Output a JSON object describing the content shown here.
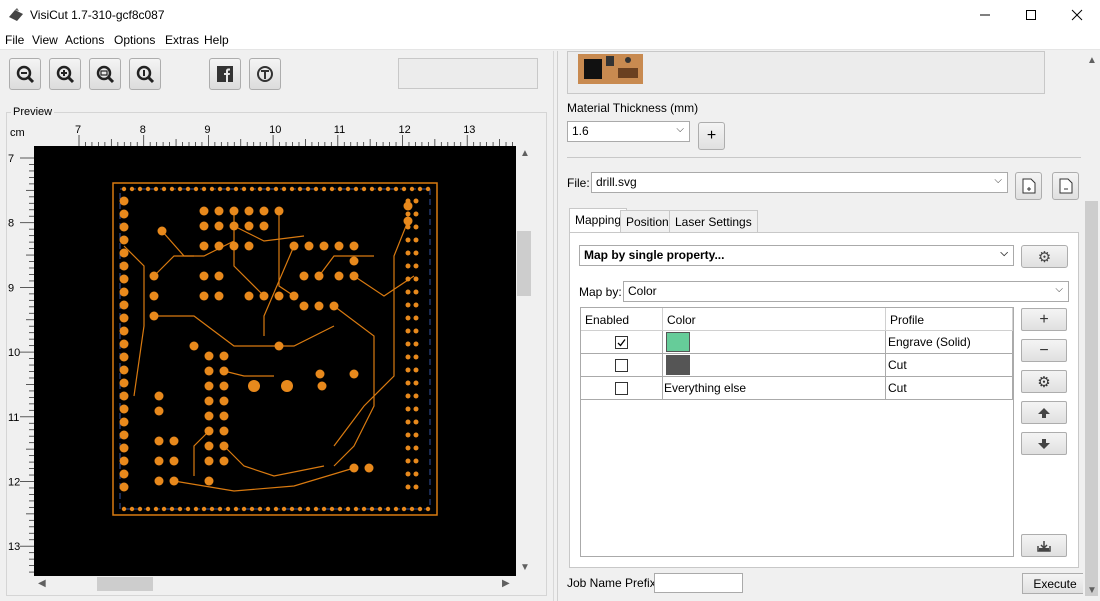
{
  "window": {
    "title": "VisiCut 1.7-310-gcf8c087"
  },
  "menu": {
    "file": "File",
    "view": "View",
    "actions": "Actions",
    "options": "Options",
    "extras": "Extras",
    "help": "Help"
  },
  "toolbar": {
    "icons": [
      "zoom-out-icon",
      "zoom-in-icon",
      "zoom-fit-icon",
      "zoom-100-icon",
      "facebook-icon",
      "thingiverse-icon"
    ]
  },
  "preview": {
    "label": "Preview",
    "unit": "cm",
    "x_ticks": [
      "7",
      "8",
      "9",
      "10",
      "11",
      "12",
      "13"
    ],
    "y_ticks": [
      "7",
      "8",
      "9",
      "10",
      "11",
      "12",
      "13"
    ]
  },
  "material": {
    "thickness_label": "Material Thickness (mm)",
    "thickness_value": "1.6",
    "add_label": "+"
  },
  "file": {
    "label": "File:",
    "value": "drill.svg"
  },
  "tabs": {
    "mapping": "Mapping",
    "position": "Position",
    "laser_settings": "Laser Settings"
  },
  "mapping": {
    "mode": "Map by single property...",
    "map_by_label": "Map by:",
    "map_by_value": "Color",
    "columns": {
      "enabled": "Enabled",
      "color": "Color",
      "profile": "Profile"
    },
    "rows": [
      {
        "enabled": true,
        "color": "#66cc99",
        "color_text": "",
        "profile": "Engrave (Solid)"
      },
      {
        "enabled": false,
        "color": "#555555",
        "color_text": "",
        "profile": "Cut"
      },
      {
        "enabled": false,
        "color": "",
        "color_text": "Everything else",
        "profile": "Cut"
      }
    ]
  },
  "job": {
    "prefix_label": "Job Name Prefix:",
    "prefix_value": "",
    "execute_label": "Execute"
  },
  "colors": {
    "pad": "#e8891c",
    "trace": "#d97a10",
    "canvas": "#000000",
    "accent": "#0078d7"
  }
}
